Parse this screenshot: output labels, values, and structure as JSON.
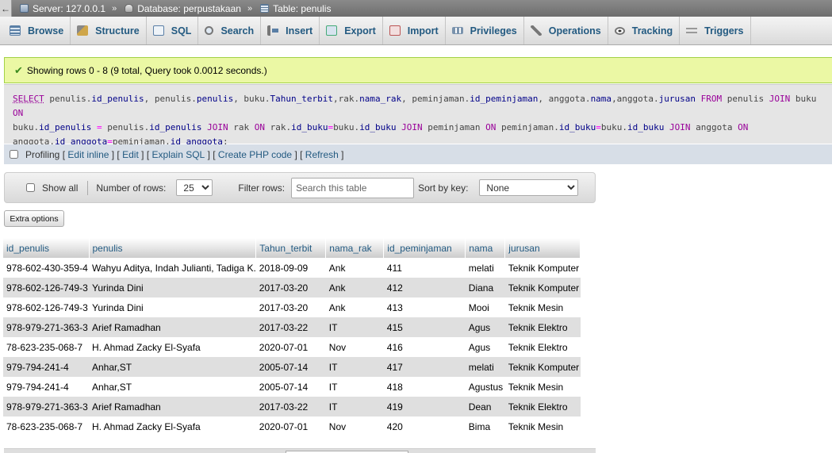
{
  "breadcrumb": {
    "back_label": "←",
    "items": [
      {
        "label": "Server: 127.0.0.1",
        "icon": "server-icon"
      },
      {
        "label": "Database: perpustakaan",
        "icon": "database-icon"
      },
      {
        "label": "Table: penulis",
        "icon": "table-icon"
      }
    ],
    "separator": "»"
  },
  "tabs": [
    {
      "label": "Browse",
      "icon": "browse-icon"
    },
    {
      "label": "Structure",
      "icon": "structure-icon"
    },
    {
      "label": "SQL",
      "icon": "sql-icon"
    },
    {
      "label": "Search",
      "icon": "search-icon"
    },
    {
      "label": "Insert",
      "icon": "insert-icon"
    },
    {
      "label": "Export",
      "icon": "export-icon"
    },
    {
      "label": "Import",
      "icon": "import-icon"
    },
    {
      "label": "Privileges",
      "icon": "privileges-icon"
    },
    {
      "label": "Operations",
      "icon": "operations-icon"
    },
    {
      "label": "Tracking",
      "icon": "tracking-icon"
    },
    {
      "label": "Triggers",
      "icon": "triggers-icon"
    }
  ],
  "message": {
    "text": "Showing rows 0 - 8 (9 total, Query took 0.0012 seconds.)",
    "icon": "check-icon"
  },
  "sql": {
    "t_select": "SELECT",
    "t_from": "FROM",
    "t_join": "JOIN",
    "t_on": "ON",
    "t_eq": "=",
    "l1_a": " penulis.",
    "l1_b": "id_penulis",
    "l1_c": ", penulis.",
    "l1_d": "penulis",
    "l1_e": ", buku.",
    "l1_f": "Tahun_terbit",
    "l1_g": ",rak.",
    "l1_h": "nama_rak",
    "l1_i": ", peminjaman.",
    "l1_j": "id_peminjaman",
    "l1_k": ", anggota.",
    "l1_l": "nama",
    "l1_m": ",anggota.",
    "l1_n": "jurusan",
    "l1_o": " penulis ",
    "l1_p": " buku ",
    "l2_a": "buku.",
    "l2_b": "id_penulis",
    "l2_c": " penulis.",
    "l2_d": "id_penulis",
    "l2_e": " rak ",
    "l2_f": " rak.",
    "l2_g": "id_buku",
    "l2_h": "buku.",
    "l2_i": "id_buku",
    "l2_j": " peminjaman ",
    "l2_k": " peminjaman.",
    "l2_l": "id_buku",
    "l2_m": "buku.",
    "l2_n": "id_buku",
    "l2_o": " anggota ",
    "l3_a": "anggota.",
    "l3_b": "id_anggota",
    "l3_c": "peminjaman.",
    "l3_d": "id_anggota",
    "l3_e": ";"
  },
  "profiling": {
    "label": "Profiling",
    "links": [
      "Edit inline",
      "Edit",
      "Explain SQL",
      "Create PHP code",
      "Refresh"
    ]
  },
  "navigation": {
    "show_all_label": "Show all",
    "rows_label": "Number of rows:",
    "rows_value": "25",
    "filter_label": "Filter rows:",
    "filter_placeholder": "Search this table",
    "sort_label": "Sort by key:",
    "sort_value": "None"
  },
  "extra_options_label": "Extra options",
  "table": {
    "columns": [
      "id_penulis",
      "penulis",
      "Tahun_terbit",
      "nama_rak",
      "id_peminjaman",
      "nama",
      "jurusan"
    ],
    "rows": [
      [
        "978-602-430-359-4",
        "Wahyu Aditya, Indah Julianti, Tadiga K.",
        "2018-09-09",
        "Ank",
        "411",
        "melati",
        "Teknik Komputer"
      ],
      [
        "978-602-126-749-3",
        "Yurinda Dini",
        "2017-03-20",
        "Ank",
        "412",
        "Diana",
        "Teknik Komputer"
      ],
      [
        "978-602-126-749-3",
        "Yurinda Dini",
        "2017-03-20",
        "Ank",
        "413",
        "Mooi",
        "Teknik Mesin"
      ],
      [
        "978-979-271-363-3",
        "Arief Ramadhan",
        "2017-03-22",
        "IT",
        "415",
        "Agus",
        "Teknik Elektro"
      ],
      [
        "78-623-235-068-7",
        "H. Ahmad Zacky El-Syafa",
        "2020-07-01",
        "Nov",
        "416",
        "Agus",
        "Teknik Elektro"
      ],
      [
        "979-794-241-4",
        "Anhar,ST",
        "2005-07-14",
        "IT",
        "417",
        "melati",
        "Teknik Komputer"
      ],
      [
        "979-794-241-4",
        "Anhar,ST",
        "2005-07-14",
        "IT",
        "418",
        "Agustus",
        "Teknik Mesin"
      ],
      [
        "978-979-271-363-3",
        "Arief Ramadhan",
        "2017-03-22",
        "IT",
        "419",
        "Dean",
        "Teknik Elektro"
      ],
      [
        "78-623-235-068-7",
        "H. Ahmad Zacky El-Syafa",
        "2020-07-01",
        "Nov",
        "420",
        "Bima",
        "Teknik Mesin"
      ]
    ]
  }
}
